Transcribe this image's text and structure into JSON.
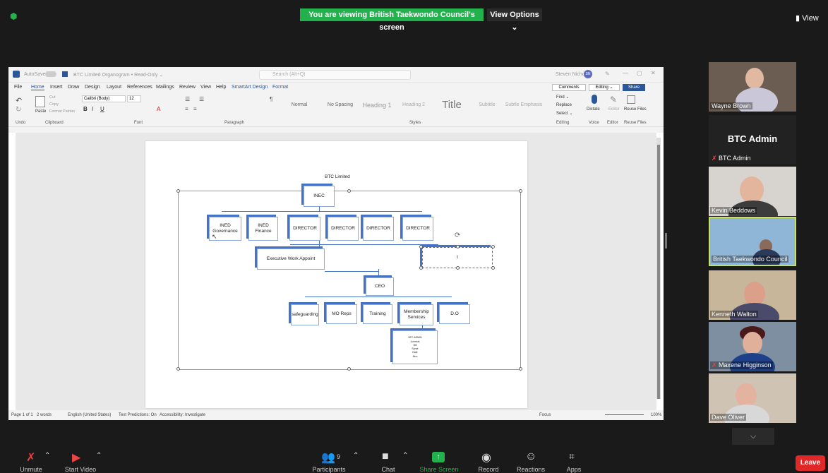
{
  "banner": {
    "viewing": "You are viewing British Taekwondo Council's screen",
    "view_options": "View Options ⌄",
    "view_right": "View"
  },
  "word": {
    "autosave": "AutoSave",
    "doc_title": "BTC Limited Organogram • Read-Only ⌄",
    "search": "Search (Alt+Q)",
    "user": "Steven Nichols",
    "user_initials": "SN",
    "menu": [
      "File",
      "Home",
      "Insert",
      "Draw",
      "Design",
      "Layout",
      "References",
      "Mailings",
      "Review",
      "View",
      "Help",
      "SmartArt Design",
      "Format"
    ],
    "comments": "Comments",
    "editing": "Editing ⌄",
    "share": "Share",
    "ribbon_groups": [
      "Undo",
      "Clipboard",
      "Font",
      "Paragraph",
      "Styles",
      "Editing",
      "Voice",
      "Editor",
      "Reuse Files"
    ],
    "font_name": "Calibri (Body)",
    "font_size": "12",
    "paste": "Paste",
    "cut": "Cut",
    "copy": "Copy",
    "format_painter": "Format Painter",
    "styles": [
      "Normal",
      "No Spacing",
      "Heading 1",
      "Heading 2",
      "Title",
      "Subtitle",
      "Subtle Emphasis"
    ],
    "find": "Find ⌄",
    "replace": "Replace",
    "select": "Select ⌄",
    "dictate": "Dictate",
    "editor": "Editor",
    "reuse": "Reuse Files",
    "status": {
      "page": "Page 1 of 1",
      "words": "2 words",
      "lang": "English (United States)",
      "predictions": "Text Predictions: On",
      "access": "Accessibility: Investigate",
      "focus": "Focus",
      "zoom": "100%"
    }
  },
  "org": {
    "title": "BTC Limited",
    "top": "INEC",
    "row2": [
      "INED Governance",
      "INED Finance",
      "DIRECTOR",
      "DIRECTOR",
      "DIRECTOR",
      "DIRECTOR"
    ],
    "exec": "Executive Work Appoint",
    "t_box": "t",
    "ceo": "CEO",
    "row4": [
      "safeguarding",
      "MO Reps",
      "Training",
      "Membership Services",
      "D.O"
    ],
    "sub_lines": [
      "BTC ADMIN",
      "Licensin",
      "Bill",
      "Sandr",
      "Dale",
      "Moo"
    ]
  },
  "participants": [
    {
      "name": "Wayne Brown"
    },
    {
      "name": "BTC Admin",
      "big": "BTC Admin"
    },
    {
      "name": "Kevin Beddows"
    },
    {
      "name": "British Taekwondo Council"
    },
    {
      "name": "Kenneth Walton"
    },
    {
      "name": "Maxene Higginson"
    },
    {
      "name": "Dave Oliver"
    }
  ],
  "toolbar": {
    "unmute": "Unmute",
    "start_video": "Start Video",
    "participants": "Participants",
    "participants_count": "9",
    "chat": "Chat",
    "share": "Share Screen",
    "record": "Record",
    "reactions": "Reactions",
    "apps": "Apps",
    "leave": "Leave"
  }
}
